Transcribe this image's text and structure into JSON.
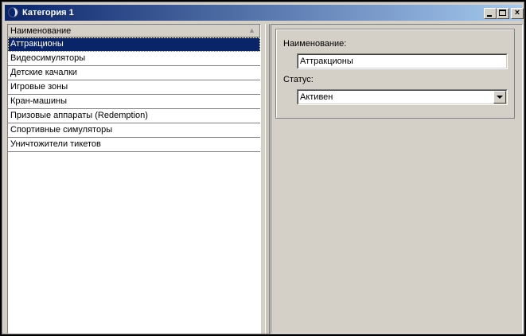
{
  "window": {
    "title": "Категория 1"
  },
  "list": {
    "column_header": "Наименование",
    "rows": [
      "Аттракционы",
      "Видеосимуляторы",
      "Детские качалки",
      "Игровые зоны",
      "Кран-машины",
      "Призовые аппараты (Redemption)",
      "Спортивные симуляторы",
      "Уничтожители тикетов"
    ],
    "selected_index": 0
  },
  "form": {
    "name_label": "Наименование:",
    "name_value": "Аттракционы",
    "status_label": "Статус:",
    "status_value": "Активен"
  },
  "colors": {
    "titlebar_start": "#0a246a",
    "titlebar_end": "#a6caf0",
    "selection": "#0a246a",
    "face": "#d4d0c8"
  },
  "icons": {
    "title": "app-icon",
    "sort": "sort-ascending-icon",
    "dropdown": "chevron-down-icon"
  }
}
